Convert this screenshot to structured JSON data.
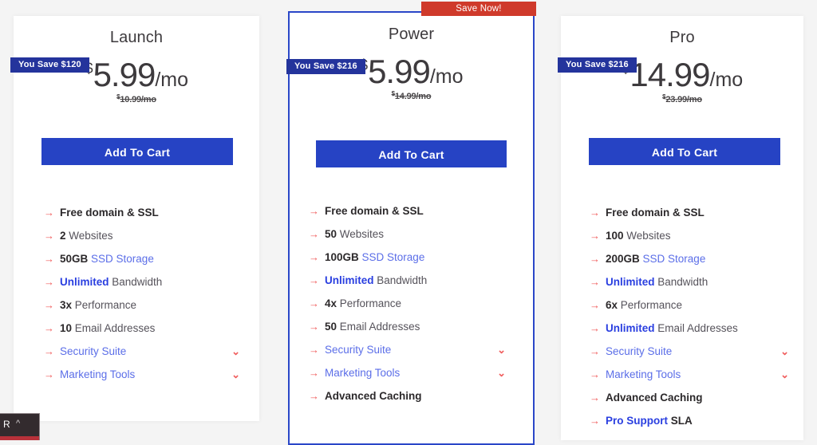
{
  "ribbon": {
    "label": "Save Now!",
    "color": "#cf3a2b"
  },
  "theme": {
    "cta_color": "#2643c4",
    "badge_color": "#24349c",
    "accent_red": "#f05b5b",
    "accent_blue": "#5b6ee8",
    "page_bg": "#f4f4f4"
  },
  "plans": [
    {
      "id": "launch",
      "title": "Launch",
      "save_badge": "You Save $120",
      "price": {
        "currency": "$",
        "amount": "5.99",
        "period": "/mo"
      },
      "old_price": {
        "currency": "$",
        "text": "10.99/mo"
      },
      "cta_label": "Add To Cart",
      "features": [
        {
          "icon": "arrow-right-icon",
          "lead": "Free domain & SSL",
          "rest": "",
          "lead_style": "bold",
          "rest_style": "plain",
          "chevron": false
        },
        {
          "icon": "arrow-right-icon",
          "lead": "2",
          "rest": " Websites",
          "lead_style": "bold",
          "rest_style": "plain",
          "chevron": false
        },
        {
          "icon": "arrow-right-icon",
          "lead": "50GB",
          "rest": " SSD Storage",
          "lead_style": "bold",
          "rest_style": "accent",
          "chevron": false
        },
        {
          "icon": "arrow-right-icon",
          "lead": "Unlimited",
          "rest": " Bandwidth",
          "lead_style": "bold-accent",
          "rest_style": "plain",
          "chevron": false
        },
        {
          "icon": "arrow-right-icon",
          "lead": "3x",
          "rest": " Performance",
          "lead_style": "bold",
          "rest_style": "plain",
          "chevron": false
        },
        {
          "icon": "arrow-right-icon",
          "lead": "10",
          "rest": " Email Addresses",
          "lead_style": "bold",
          "rest_style": "plain",
          "chevron": false
        },
        {
          "icon": "arrow-right-icon",
          "lead": "",
          "rest": "Security Suite",
          "lead_style": "none",
          "rest_style": "link",
          "chevron": true,
          "chevron_icon": "chevron-down-icon"
        },
        {
          "icon": "arrow-right-icon",
          "lead": "",
          "rest": " Marketing Tools",
          "lead_style": "none",
          "rest_style": "link",
          "chevron": true,
          "chevron_icon": "chevron-down-icon"
        }
      ]
    },
    {
      "id": "power",
      "title": "Power",
      "featured": true,
      "save_badge": "You Save $216",
      "price": {
        "currency": "$",
        "amount": "5.99",
        "period": "/mo"
      },
      "old_price": {
        "currency": "$",
        "text": "14.99/mo"
      },
      "cta_label": "Add To Cart",
      "features": [
        {
          "icon": "arrow-right-icon",
          "lead": "Free domain & SSL",
          "rest": "",
          "lead_style": "bold",
          "rest_style": "plain",
          "chevron": false
        },
        {
          "icon": "arrow-right-icon",
          "lead": "50",
          "rest": " Websites",
          "lead_style": "bold",
          "rest_style": "plain",
          "chevron": false
        },
        {
          "icon": "arrow-right-icon",
          "lead": "100GB",
          "rest": " SSD Storage",
          "lead_style": "bold",
          "rest_style": "accent",
          "chevron": false
        },
        {
          "icon": "arrow-right-icon",
          "lead": "Unlimited",
          "rest": " Bandwidth",
          "lead_style": "bold-accent",
          "rest_style": "plain",
          "chevron": false
        },
        {
          "icon": "arrow-right-icon",
          "lead": "4x",
          "rest": " Performance",
          "lead_style": "bold",
          "rest_style": "plain",
          "chevron": false
        },
        {
          "icon": "arrow-right-icon",
          "lead": "50",
          "rest": " Email Addresses",
          "lead_style": "bold",
          "rest_style": "plain",
          "chevron": false
        },
        {
          "icon": "arrow-right-icon",
          "lead": "",
          "rest": "Security Suite",
          "lead_style": "none",
          "rest_style": "link",
          "chevron": true,
          "chevron_icon": "chevron-down-icon"
        },
        {
          "icon": "arrow-right-icon",
          "lead": "",
          "rest": " Marketing Tools",
          "lead_style": "none",
          "rest_style": "link",
          "chevron": true,
          "chevron_icon": "chevron-down-icon"
        },
        {
          "icon": "arrow-right-icon",
          "lead": "Advanced Caching",
          "rest": "",
          "lead_style": "bold",
          "rest_style": "plain",
          "chevron": false
        }
      ]
    },
    {
      "id": "pro",
      "title": "Pro",
      "save_badge": "You Save $216",
      "price": {
        "currency": "$",
        "amount": "14.99",
        "period": "/mo"
      },
      "old_price": {
        "currency": "$",
        "text": "23.99/mo"
      },
      "cta_label": "Add To Cart",
      "features": [
        {
          "icon": "arrow-right-icon",
          "lead": "Free domain & SSL",
          "rest": "",
          "lead_style": "bold",
          "rest_style": "plain",
          "chevron": false
        },
        {
          "icon": "arrow-right-icon",
          "lead": "100",
          "rest": " Websites",
          "lead_style": "bold",
          "rest_style": "plain",
          "chevron": false
        },
        {
          "icon": "arrow-right-icon",
          "lead": "200GB",
          "rest": " SSD Storage",
          "lead_style": "bold",
          "rest_style": "accent",
          "chevron": false
        },
        {
          "icon": "arrow-right-icon",
          "lead": "Unlimited",
          "rest": " Bandwidth",
          "lead_style": "bold-accent",
          "rest_style": "plain",
          "chevron": false
        },
        {
          "icon": "arrow-right-icon",
          "lead": "6x",
          "rest": " Performance",
          "lead_style": "bold",
          "rest_style": "plain",
          "chevron": false
        },
        {
          "icon": "arrow-right-icon",
          "lead": "Unlimited",
          "rest": " Email Addresses",
          "lead_style": "bold-accent",
          "rest_style": "plain",
          "chevron": false
        },
        {
          "icon": "arrow-right-icon",
          "lead": "",
          "rest": "Security Suite",
          "lead_style": "none",
          "rest_style": "link",
          "chevron": true,
          "chevron_icon": "chevron-down-icon"
        },
        {
          "icon": "arrow-right-icon",
          "lead": "",
          "rest": " Marketing Tools",
          "lead_style": "none",
          "rest_style": "link",
          "chevron": true,
          "chevron_icon": "chevron-down-icon"
        },
        {
          "icon": "arrow-right-icon",
          "lead": "Advanced Caching",
          "rest": "",
          "lead_style": "bold",
          "rest_style": "plain",
          "chevron": false
        },
        {
          "icon": "arrow-right-icon",
          "lead": "Pro Support",
          "rest": " SLA",
          "lead_style": "bold-accent",
          "rest_style": "dark",
          "chevron": false
        }
      ]
    }
  ],
  "chat_widget": {
    "label": "R",
    "caret_icon": "caret-up-icon"
  }
}
